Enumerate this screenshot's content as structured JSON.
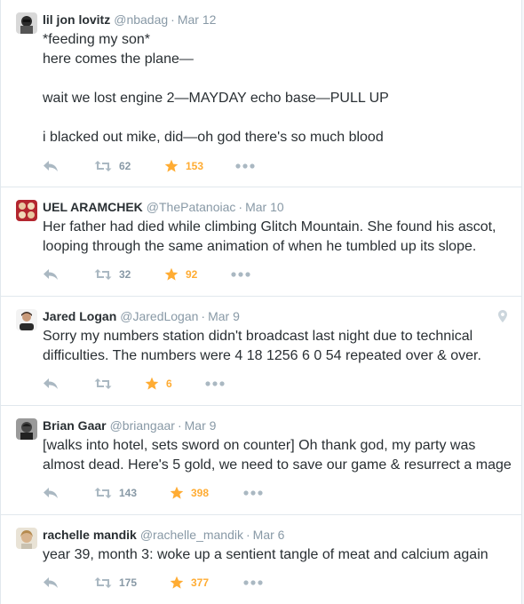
{
  "colors": {
    "muted": "#8899a6",
    "favorite_active": "#ffac33",
    "text": "#292f33",
    "divider": "#e1e8ed"
  },
  "tweets": [
    {
      "name": "lil jon lovitz",
      "handle": "@nbadag",
      "time": "Mar 12",
      "lines": [
        "*feeding my son*",
        "here comes the plane—",
        "",
        "wait we lost engine 2—MAYDAY echo base—PULL UP",
        "",
        "i blacked out mike, did—oh god there's so much blood"
      ],
      "retweets": "62",
      "favorites": "153",
      "icons": [
        "reply-icon",
        "retweet-icon",
        "star-icon",
        "more-icon"
      ]
    },
    {
      "name": "UEL ARAMCHEK",
      "handle": "@ThePatanoiac",
      "time": "Mar 10",
      "lines": [
        "Her father had died while climbing Glitch Mountain. She found his ascot,",
        "looping through the same animation of when he tumbled up its slope."
      ],
      "retweets": "32",
      "favorites": "92",
      "icons": [
        "reply-icon",
        "retweet-icon",
        "star-icon",
        "more-icon"
      ]
    },
    {
      "name": "Jared Logan",
      "handle": "@JaredLogan",
      "time": "Mar 9",
      "lines": [
        "Sorry my numbers station didn't broadcast last night due to technical",
        "difficulties. The numbers were 4 18 1256 6 0 54 repeated over & over."
      ],
      "retweets": "",
      "favorites": "6",
      "icons": [
        "reply-icon",
        "retweet-icon",
        "star-icon",
        "more-icon",
        "location-pin-icon"
      ]
    },
    {
      "name": "Brian Gaar",
      "handle": "@briangaar",
      "time": "Mar 9",
      "lines": [
        "[walks into hotel, sets sword on counter] Oh thank god, my party was",
        "almost dead. Here's 5 gold, we need to save our game & resurrect a mage"
      ],
      "retweets": "143",
      "favorites": "398",
      "icons": [
        "reply-icon",
        "retweet-icon",
        "star-icon",
        "more-icon"
      ]
    },
    {
      "name": "rachelle mandik",
      "handle": "@rachelle_mandik",
      "time": "Mar 6",
      "lines": [
        "year 39, month 3: woke up a sentient tangle of meat and calcium again"
      ],
      "retweets": "175",
      "favorites": "377",
      "icons": [
        "reply-icon",
        "retweet-icon",
        "star-icon",
        "more-icon"
      ]
    }
  ]
}
